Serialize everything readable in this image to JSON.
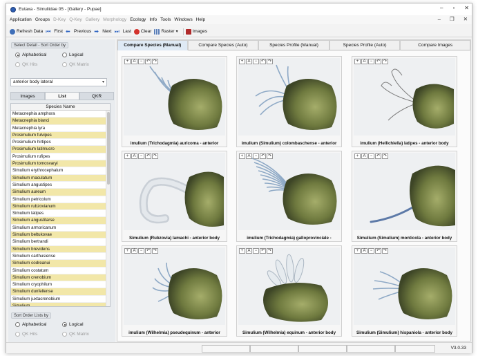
{
  "window": {
    "title": "Eutaxa - Simuliidae 05 - [Gallery - Pupae]"
  },
  "menu": [
    "Application",
    "Groups",
    "D-Key",
    "Q-Key",
    "Gallery",
    "Morphology",
    "Ecology",
    "Info",
    "Tools",
    "Windows",
    "Help"
  ],
  "menu_disabled": [
    false,
    false,
    true,
    true,
    true,
    true,
    false,
    false,
    false,
    false,
    false
  ],
  "toolbar": {
    "refresh": "Refresh Data",
    "first": "First",
    "previous": "Previous",
    "next": "Next",
    "last": "Last",
    "clear": "Clear",
    "raster": "Raster",
    "images": "Images"
  },
  "left": {
    "select_detail_label": "Select Detail - Sort Order by",
    "sort_top": {
      "alphabetical": "Alphabetical",
      "logical": "Logical",
      "qk_hits": "QK Hits",
      "qk_matrix": "QK Matrix"
    },
    "detail_value": "anterior body lateral",
    "tabs": [
      "Images",
      "List",
      "QKR"
    ],
    "list_header": "Species Name",
    "species": [
      {
        "name": "Metacnephia amphora",
        "hl": false
      },
      {
        "name": "Metacnephia blanci",
        "hl": true
      },
      {
        "name": "Metacnephia lyra",
        "hl": false
      },
      {
        "name": "Prosimulium fulvipes",
        "hl": true
      },
      {
        "name": "Prosimulium hirtipes",
        "hl": false
      },
      {
        "name": "Prosimulium latimucro",
        "hl": true
      },
      {
        "name": "Prosimulium rufipes",
        "hl": false
      },
      {
        "name": "Prosimulium tomosvaryi",
        "hl": true
      },
      {
        "name": "Simulium erythrocephalum",
        "hl": false
      },
      {
        "name": "Simulium maculatum",
        "hl": true
      },
      {
        "name": "Simulium angustipes",
        "hl": false
      },
      {
        "name": "Simulium aureum",
        "hl": true
      },
      {
        "name": "Simulium petricolum",
        "hl": false
      },
      {
        "name": "Simulium rubzovianum",
        "hl": true
      },
      {
        "name": "Simulium latipes",
        "hl": false
      },
      {
        "name": "Simulium angustitarse",
        "hl": true
      },
      {
        "name": "Simulium armoricanum",
        "hl": false
      },
      {
        "name": "Simulium beltukovae",
        "hl": true
      },
      {
        "name": "Simulium bertrandi",
        "hl": false
      },
      {
        "name": "Simulium brevidens",
        "hl": true
      },
      {
        "name": "Simulium carthusiense",
        "hl": false
      },
      {
        "name": "Simulium codreanui",
        "hl": true
      },
      {
        "name": "Simulium costatum",
        "hl": false
      },
      {
        "name": "Simulium crenobium",
        "hl": true
      },
      {
        "name": "Simulium cryophilum",
        "hl": false
      },
      {
        "name": "Simulium dunfellense",
        "hl": true
      },
      {
        "name": "Simulium juxtacrenobium",
        "hl": false
      },
      {
        "name": "Simulium ...",
        "hl": true
      }
    ],
    "sort_lists_label": "Sort Order Lists by",
    "sort_bottom": {
      "alphabetical": "Alphabetical",
      "logical": "Logical",
      "qk_hits": "QK Hits",
      "qk_matrix": "QK Matrix"
    }
  },
  "main": {
    "tabs": [
      "Compare Species (Manual)",
      "Compare Species (Auto)",
      "Species Profile (Manual)",
      "Species Profile (Auto)",
      "Compare Images"
    ],
    "cells": [
      {
        "caption": "imulium (Trichodagmia) auricoma - anterior",
        "shape": "filaments-few"
      },
      {
        "caption": "imulium (Simulium) colombaschense - anterior",
        "shape": "filaments-blue"
      },
      {
        "caption": "imulium (Hellichiella) latipes - anterior body",
        "shape": "filaments-thin"
      },
      {
        "caption": "Simulium (Rubzovia) lamachi - anterior body",
        "shape": "tube"
      },
      {
        "caption": "imulium (Trichodagmia) galloprovinciale -",
        "shape": "filaments-many"
      },
      {
        "caption": "Simulium (Simulium) monticola - anterior body",
        "shape": "horn"
      },
      {
        "caption": "imulium (Wilhelmia) pseudequinum - anterior",
        "shape": "tuft"
      },
      {
        "caption": "Simulium (Wilhelmia) equinum - anterior body",
        "shape": "fingers"
      },
      {
        "caption": "Simulium (Simulium) hispaniola - anterior body",
        "shape": "filaments-left"
      }
    ]
  },
  "status": {
    "version": "V3.0.33"
  },
  "colors": {
    "highlight_row": "#f2e7a8",
    "active_tab": "#dfeaf5",
    "pupa_body": "#7f8a4a",
    "gill": "#9fb2c8"
  }
}
